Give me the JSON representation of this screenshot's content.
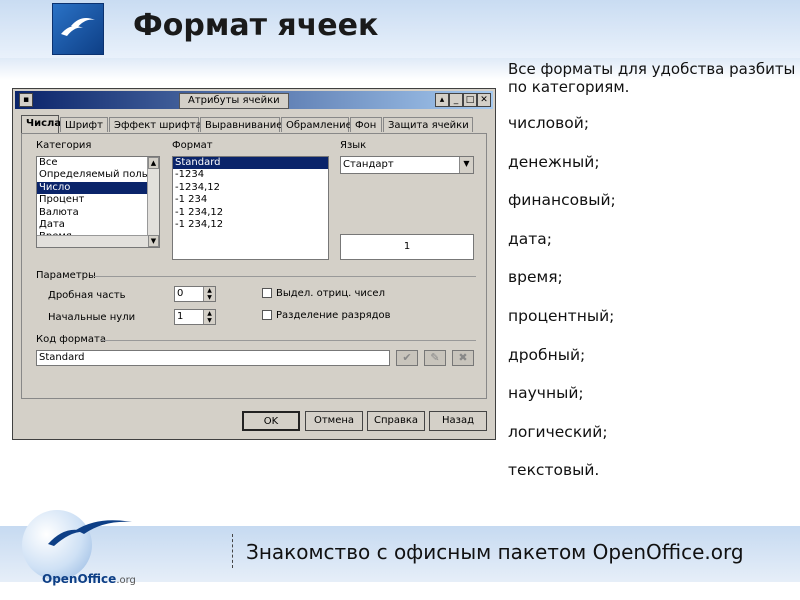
{
  "slide": {
    "title": "Формат ячеек",
    "intro": "Все форматы для удобства разбиты по категориям.",
    "categories": [
      "числовой;",
      "денежный;",
      "финансовый;",
      "дата;",
      "время;",
      "процентный;",
      "дробный;",
      "научный;",
      "логический;",
      "текстовый."
    ],
    "footer_text": "Знакомство с офисным пакетом OpenOffice.org",
    "footer_logo_main": "OpenOffice",
    "footer_logo_suffix": ".org"
  },
  "dialog": {
    "title": "Атрибуты ячейки",
    "tabs": [
      "Числа",
      "Шрифт",
      "Эффект шрифта",
      "Выравнивание",
      "Обрамление",
      "Фон",
      "Защита ячейки"
    ],
    "active_tab": "Числа",
    "category_label": "Категория",
    "category_items": [
      "Все",
      "Определяемый пользо",
      "Число",
      "Процент",
      "Валюта",
      "Дата",
      "Время"
    ],
    "category_selected": "Число",
    "format_label": "Формат",
    "format_items": [
      "Standard",
      "-1234",
      "-1234,12",
      "-1 234",
      "-1 234,12",
      "-1 234,12"
    ],
    "format_selected": "Standard",
    "language_label": "Язык",
    "language_value": "Стандарт",
    "preview_value": "1",
    "params_label": "Параметры",
    "decimal_label": "Дробная часть",
    "decimal_value": "0",
    "leading_zeros_label": "Начальные нули",
    "leading_zeros_value": "1",
    "negative_red_label": "Выдел. отриц. чисел",
    "negative_red_checked": false,
    "thousands_sep_label": "Разделение разрядов",
    "thousands_sep_checked": false,
    "format_code_label": "Код формата",
    "format_code_value": "Standard",
    "buttons": {
      "ok": "OK",
      "cancel": "Отмена",
      "help": "Справка",
      "back": "Назад"
    }
  },
  "colors": {
    "selection": "#0a246a",
    "titlebar": "#0a246a",
    "dialog_bg": "#d4d0c8",
    "band": "#c9dcf2"
  }
}
